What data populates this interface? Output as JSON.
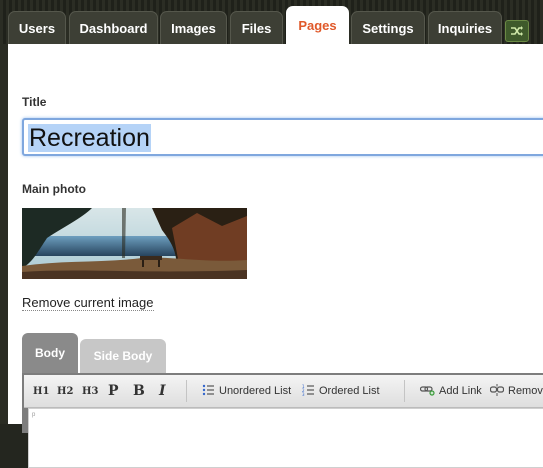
{
  "nav": {
    "tabs": [
      {
        "label": "Users"
      },
      {
        "label": "Dashboard"
      },
      {
        "label": "Images"
      },
      {
        "label": "Files"
      },
      {
        "label": "Pages"
      },
      {
        "label": "Settings"
      },
      {
        "label": "Inquiries"
      }
    ],
    "active_tab": "Pages",
    "extra_icon": "shuffle-icon"
  },
  "form": {
    "title_label": "Title",
    "title_value": "Recreation",
    "photo_label": "Main photo",
    "remove_image_link": "Remove current image"
  },
  "editor": {
    "tabs": [
      {
        "label": "Body"
      },
      {
        "label": "Side Body"
      }
    ],
    "active_tab": "Body",
    "toolbar": {
      "h1": "H1",
      "h2": "H2",
      "h3": "H3",
      "p": "P",
      "b": "B",
      "i": "I",
      "unordered_list": "Unordered List",
      "ordered_list": "Ordered List",
      "add_link": "Add Link",
      "remove": "Remove"
    },
    "content_marker": "p"
  },
  "colors": {
    "active_tab_text": "#e0592a",
    "tab_bg": "#3d3f35",
    "selection": "#b5d3f7",
    "focus_border": "#7fa7de"
  }
}
